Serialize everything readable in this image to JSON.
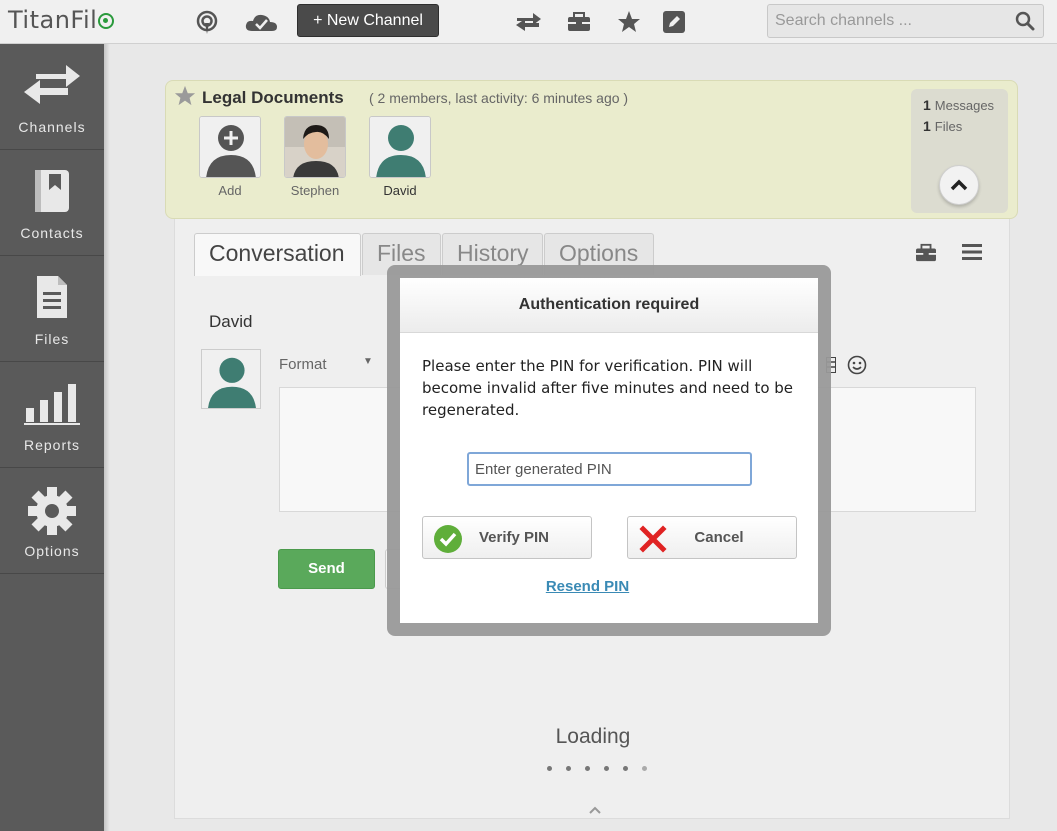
{
  "header": {
    "logo_text": "TitanFil",
    "new_channel_label": "+ New Channel",
    "search_placeholder": "Search channels ..."
  },
  "sidebar": {
    "items": [
      {
        "label": "Channels",
        "icon": "arrows-icon"
      },
      {
        "label": "Contacts",
        "icon": "book-icon"
      },
      {
        "label": "Files",
        "icon": "document-icon"
      },
      {
        "label": "Reports",
        "icon": "bar-chart-icon"
      },
      {
        "label": "Options",
        "icon": "gear-icon"
      }
    ]
  },
  "channel": {
    "title": "Legal Documents",
    "meta": "( 2 members, last activity: 6 minutes ago )",
    "members": [
      {
        "name": "Add"
      },
      {
        "name": "Stephen"
      },
      {
        "name": "David"
      }
    ],
    "stats": {
      "messages_count": "1",
      "messages_label": "Messages",
      "files_count": "1",
      "files_label": "Files"
    }
  },
  "tabs": [
    {
      "label": "Conversation",
      "active": true
    },
    {
      "label": "Files"
    },
    {
      "label": "History"
    },
    {
      "label": "Options"
    }
  ],
  "compose": {
    "author": "David",
    "format_label": "Format",
    "send_label": "Send"
  },
  "loading": {
    "text": "Loading"
  },
  "modal": {
    "title": "Authentication required",
    "message": "Please enter the PIN for verification. PIN will become invalid after five minutes and need to be regenerated.",
    "pin_placeholder": "Enter generated PIN",
    "verify_label": "Verify PIN",
    "cancel_label": "Cancel",
    "resend_label": "Resend PIN"
  },
  "colors": {
    "accent_green": "#5aa95b",
    "link_blue": "#3a8ab5",
    "sidebar_bg": "#5a5a5a",
    "card_bg": "#eaeccd"
  }
}
